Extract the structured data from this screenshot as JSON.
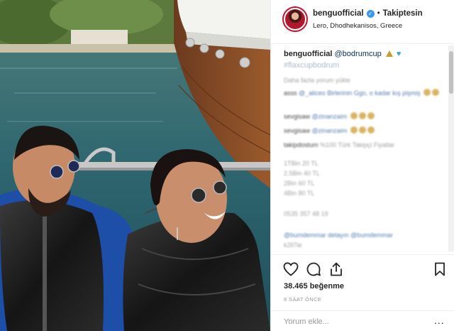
{
  "post": {
    "username": "benguofficial",
    "verified_symbol": "✓",
    "separator": "•",
    "follow_status": "Takiptesin",
    "location": "Lero, Dhodhekanisos, Greece"
  },
  "caption": {
    "username": "benguofficial",
    "mention": "@bodrumcup",
    "hashtag": "#flaxcupbodrum",
    "emojis": [
      "sailboat-emoji",
      "blue-heart-emoji"
    ]
  },
  "comments": [
    {
      "user": "",
      "text": "Daha fazla yorum yükle"
    },
    {
      "user": "asss",
      "text": "@_aliceo Birlerinin Ggo, o kadar kış pişmiş"
    },
    {
      "user": "sevgisaw",
      "text": "@zinanzaim"
    },
    {
      "user": "sevgisaw",
      "text": "@zinanzaim"
    },
    {
      "user": "takipdostum",
      "text": "%100 Türk Takipçi Fiyatlar"
    },
    {
      "user": "",
      "text": "1TBin 20 TL"
    },
    {
      "user": "",
      "text": "2.5Bin 40 TL"
    },
    {
      "user": "",
      "text": "2Bin 60 TL"
    },
    {
      "user": "",
      "text": "4Bin 80 TL"
    },
    {
      "user": "",
      "text": "0535 357 48 19"
    },
    {
      "user": "",
      "text": "@bumdemmar detayın @bumdemmar"
    },
    {
      "user": "",
      "text": "k2ll7ie"
    }
  ],
  "actions": {
    "like_icon": "heart-icon",
    "comment_icon": "comment-icon",
    "share_icon": "share-icon",
    "save_icon": "bookmark-icon"
  },
  "likes_text": "38.465 beğenme",
  "time_text": "8 SAAT ÖNCE",
  "add_comment_placeholder": "Yorum ekle...",
  "more_label": "..."
}
